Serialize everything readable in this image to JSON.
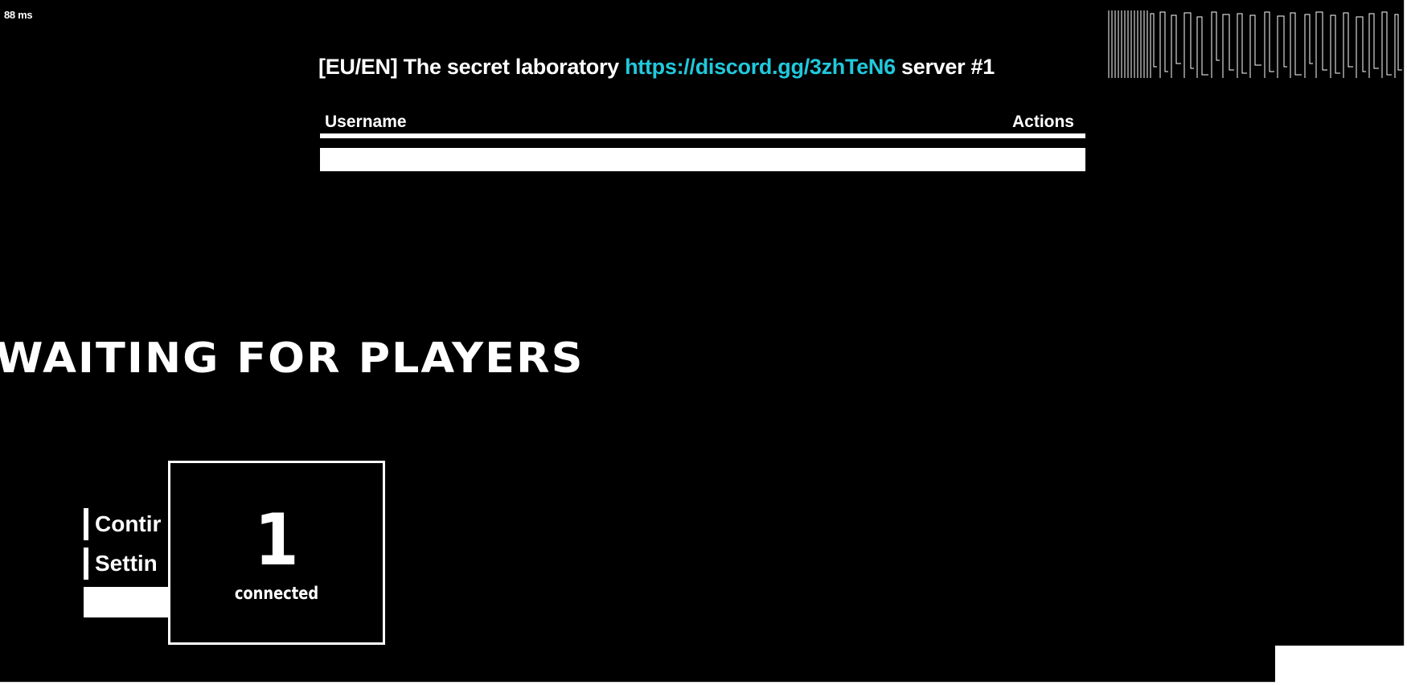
{
  "hud": {
    "ping": "88 ms"
  },
  "server": {
    "title_prefix": "[EU/EN] The secret laboratory ",
    "title_link": "https://discord.gg/3zhTeN6",
    "title_suffix": " server #1"
  },
  "player_list": {
    "columns": [
      "Username",
      "Actions"
    ],
    "rows": [
      ""
    ]
  },
  "lobby": {
    "status": "WAITING FOR PLAYERS",
    "player_count": "1",
    "player_count_label": "connected"
  },
  "menu": {
    "items": [
      {
        "label": "Contir"
      },
      {
        "label": "Settin"
      }
    ],
    "highlighted_label": ""
  },
  "colors": {
    "background": "#000000",
    "text": "#ffffff",
    "link": "#20c9dc"
  }
}
